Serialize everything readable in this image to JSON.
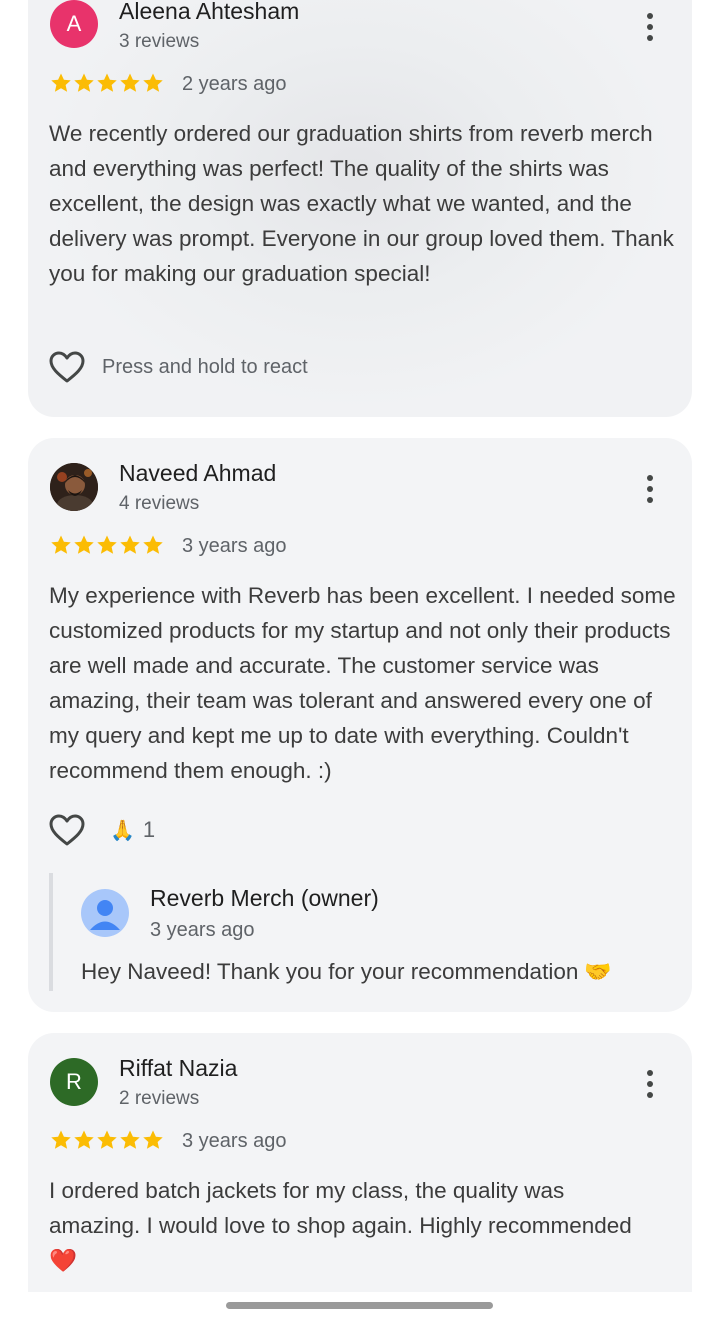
{
  "reviews": [
    {
      "avatar_letter": "A",
      "avatar_color": "#e8336b",
      "author": "Aleena Ahtesham",
      "review_count": "3 reviews",
      "rating": 5,
      "date": "2 years ago",
      "text": "We recently ordered our graduation shirts from reverb merch and everything was perfect! The quality of the shirts was excellent, the design was exactly what we wanted, and the delivery was prompt. Everyone in our group loved them. Thank you for making our graduation special!",
      "react_label": "Press and hold to react"
    },
    {
      "author": "Naveed Ahmad",
      "review_count": "4 reviews",
      "rating": 5,
      "date": "3 years ago",
      "text": "My experience with Reverb has been excellent. I needed some customized products for my startup and not only their products are well made and accurate. The customer service was amazing, their team was tolerant and answered every one of my query and kept me up to date with everything. Couldn't recommend them enough. :)",
      "reaction_emoji": "🙏",
      "reaction_count": "1",
      "owner_reply": {
        "name": "Reverb Merch (owner)",
        "date": "3 years ago",
        "text": "Hey Naveed! Thank you for your recommendation",
        "emoji": "🤝"
      }
    },
    {
      "avatar_letter": "R",
      "avatar_color": "#2d6a26",
      "author": "Riffat Nazia",
      "review_count": "2 reviews",
      "rating": 5,
      "date": "3 years ago",
      "text": "I ordered batch jackets for my class, the quality was amazing. I would love to shop again. Highly recommended",
      "text_emoji": "❤️"
    }
  ],
  "colors": {
    "star": "#fbbc04",
    "card_bg": "#f3f4f6"
  }
}
